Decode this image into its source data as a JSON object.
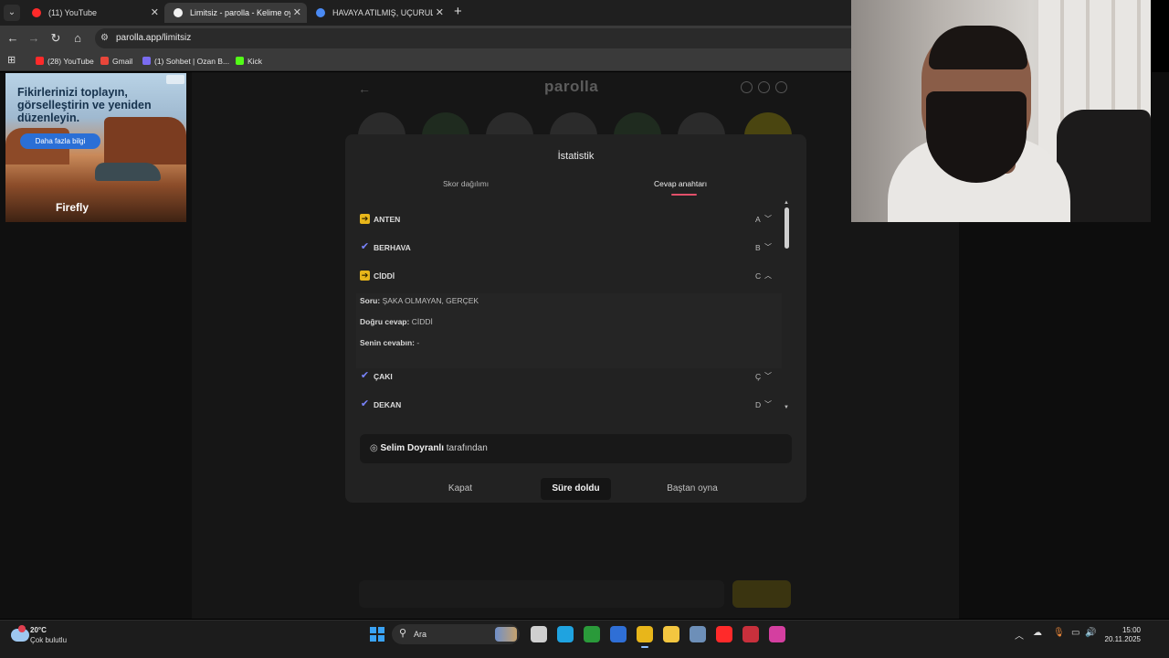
{
  "browser": {
    "tabs": [
      {
        "title": "(11) YouTube",
        "active": false,
        "favicon_color": "#ff2a2a"
      },
      {
        "title": "Limitsiz - parolla - Kelime oyunu",
        "active": true,
        "favicon_color": "#f2f2f2"
      },
      {
        "title": "HAVAYA ATILMIŞ, UÇURULMUŞ",
        "active": false,
        "favicon_color": "#4a8af4"
      }
    ],
    "new_tab_symbol": "+",
    "url": "parolla.app/limitsiz",
    "bookmarks": [
      {
        "label": "(28) YouTube",
        "icon_color": "#ff2a2a"
      },
      {
        "label": "Gmail",
        "icon_color": "#e8463a"
      },
      {
        "label": "(1) Sohbet | Ozan B...",
        "icon_color": "#7a6cf0"
      },
      {
        "label": "Kick",
        "icon_color": "#53fc18"
      }
    ]
  },
  "ad": {
    "headline": "Fikirlerinizi toplayın, görselleştirin ve yeniden düzenleyin.",
    "button": "Daha fazla bilgi",
    "brand": "Firefly"
  },
  "page": {
    "logo": "parolla",
    "back_symbol": "←",
    "circle_colors": [
      "#2b2b2b",
      "#1f2b1f",
      "#2b2b2b",
      "#2b2b2b",
      "#1f2b1f",
      "#2b2b2b",
      "#4a4510"
    ]
  },
  "modal": {
    "title": "İstatistik",
    "tabs": [
      "Skor dağılımı",
      "Cevap anahtarı"
    ],
    "active_tab": 1,
    "answers": [
      {
        "word": "ANTEN",
        "letter": "A",
        "status": "skip",
        "chevron": "down"
      },
      {
        "word": "BERHAVA",
        "letter": "B",
        "status": "ok",
        "chevron": "down"
      },
      {
        "word": "CİDDİ",
        "letter": "C",
        "status": "skip",
        "chevron": "up"
      },
      {
        "word": "ÇAKI",
        "letter": "Ç",
        "status": "ok",
        "chevron": "down"
      },
      {
        "word": "DEKAN",
        "letter": "D",
        "status": "ok",
        "chevron": "down"
      }
    ],
    "detail": {
      "question_label": "Soru:",
      "question": "ŞAKA OLMAYAN, GERÇEK",
      "answer_label": "Doğru cevap:",
      "answer": "CİDDİ",
      "yours_label": "Senin cevabın:",
      "yours": "-"
    },
    "author_symbol": "◎",
    "author_name": "Selim Doyranlı",
    "author_suffix": "tarafından",
    "buttons": {
      "close": "Kapat",
      "timer": "Süre doldu",
      "restart": "Baştan oyna"
    }
  },
  "taskbar": {
    "temperature": "20°C",
    "condition": "Çok bulutlu",
    "search_label": "Ara",
    "time": "15:00",
    "date": "20.11.2025",
    "apps": [
      {
        "name": "task-view",
        "color": "#cfcfcf",
        "active": false
      },
      {
        "name": "edge",
        "color": "#1fa3e0",
        "active": false
      },
      {
        "name": "xbox",
        "color": "#2a9a3a",
        "active": false
      },
      {
        "name": "outlook",
        "color": "#2f6fd6",
        "active": false
      },
      {
        "name": "chrome",
        "color": "#e8b61a",
        "active": true
      },
      {
        "name": "file-explorer",
        "color": "#f3c640",
        "active": false
      },
      {
        "name": "steam",
        "color": "#6d8fb8",
        "active": false
      },
      {
        "name": "youtube",
        "color": "#ff2a2a",
        "active": false
      },
      {
        "name": "app-red",
        "color": "#c8303c",
        "active": false
      },
      {
        "name": "instagram",
        "color": "#d43fa0",
        "active": false
      }
    ]
  }
}
